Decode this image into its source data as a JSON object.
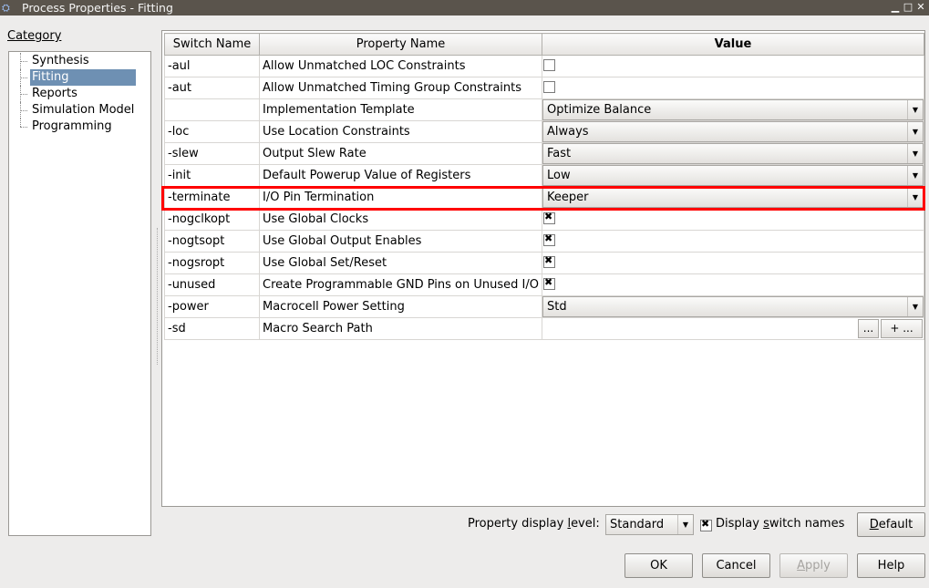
{
  "window": {
    "title": "Process Properties - Fitting",
    "icon": "⛭",
    "minimize_glyph": "▁",
    "maximize_glyph": "□",
    "close_glyph": "✕"
  },
  "category": {
    "label": "Category",
    "items": [
      {
        "label": "Synthesis",
        "selected": false
      },
      {
        "label": "Fitting",
        "selected": true
      },
      {
        "label": "Reports",
        "selected": false
      },
      {
        "label": "Simulation Model",
        "selected": false
      },
      {
        "label": "Programming",
        "selected": false
      }
    ]
  },
  "grid": {
    "headers": {
      "switch": "Switch Name",
      "property": "Property Name",
      "value": "Value"
    },
    "rows": [
      {
        "switch": "-aul",
        "property": "Allow Unmatched LOC Constraints",
        "type": "checkbox",
        "checked": false
      },
      {
        "switch": "-aut",
        "property": "Allow Unmatched Timing Group Constraints",
        "type": "checkbox",
        "checked": false
      },
      {
        "switch": "",
        "property": "Implementation Template",
        "type": "combo",
        "value": "Optimize Balance"
      },
      {
        "switch": "-loc",
        "property": "Use Location Constraints",
        "type": "combo",
        "value": "Always"
      },
      {
        "switch": "-slew",
        "property": "Output Slew Rate",
        "type": "combo",
        "value": "Fast"
      },
      {
        "switch": "-init",
        "property": "Default Powerup Value of Registers",
        "type": "combo",
        "value": "Low"
      },
      {
        "switch": "-terminate",
        "property": "I/O Pin Termination",
        "type": "combo",
        "value": "Keeper"
      },
      {
        "switch": "-nogclkopt",
        "property": "Use Global Clocks",
        "type": "checkbox",
        "checked": true
      },
      {
        "switch": "-nogtsopt",
        "property": "Use Global Output Enables",
        "type": "checkbox",
        "checked": true
      },
      {
        "switch": "-nogsropt",
        "property": "Use Global Set/Reset",
        "type": "checkbox",
        "checked": true
      },
      {
        "switch": "-unused",
        "property": "Create Programmable GND Pins on Unused I/O",
        "type": "checkbox",
        "checked": true
      },
      {
        "switch": "-power",
        "property": "Macrocell Power Setting",
        "type": "combo",
        "value": "Std"
      },
      {
        "switch": "-sd",
        "property": "Macro Search Path",
        "type": "path",
        "browse_label": "...",
        "add_label": "+ ..."
      }
    ]
  },
  "bottom": {
    "display_level_label_pre": "Property display ",
    "display_level_label_u": "l",
    "display_level_label_post": "evel:",
    "display_level_value": "Standard",
    "display_switch_pre": "Display ",
    "display_switch_u": "s",
    "display_switch_post": "witch names",
    "display_switch_checked": true,
    "default_u": "D",
    "default_rest": "efault"
  },
  "buttons": {
    "ok": "OK",
    "cancel": "Cancel",
    "apply_u": "A",
    "apply_rest": "pply",
    "help": "Help"
  },
  "colors": {
    "selection": "#6e90b3",
    "highlight": "#ff0000"
  }
}
